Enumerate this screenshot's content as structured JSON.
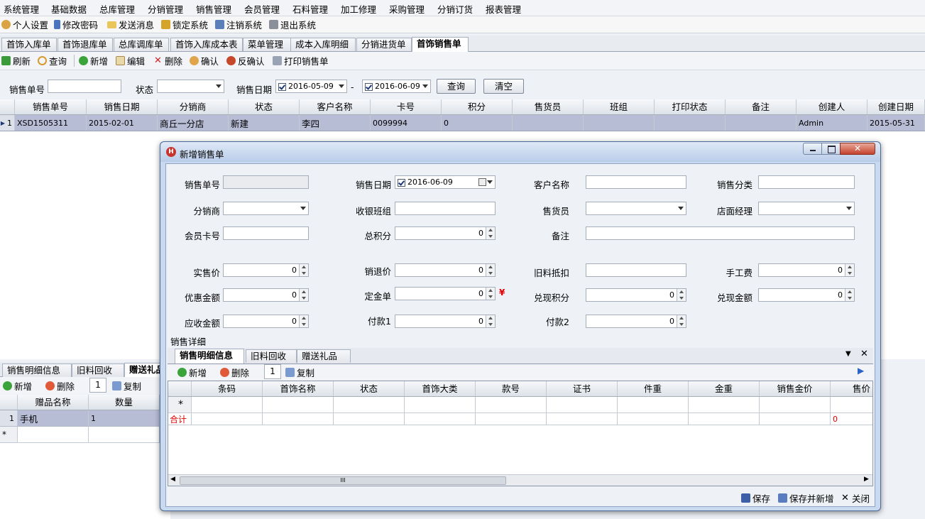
{
  "menu": [
    "系统管理",
    "基础数据",
    "总库管理",
    "分销管理",
    "销售管理",
    "会员管理",
    "石料管理",
    "加工修理",
    "采购管理",
    "分销订货",
    "报表管理"
  ],
  "quickbar": [
    {
      "label": "个人设置",
      "icon": "user-icon"
    },
    {
      "label": "修改密码",
      "icon": "key-icon"
    },
    {
      "label": "发送消息",
      "icon": "mail-icon"
    },
    {
      "label": "锁定系统",
      "icon": "lock-icon"
    },
    {
      "label": "注销系统",
      "icon": "logout-icon"
    },
    {
      "label": "退出系统",
      "icon": "home-icon"
    }
  ],
  "tabs": [
    "首饰入库单",
    "首饰退库单",
    "总库调库单",
    "首饰入库成本表",
    "菜单管理",
    "成本入库明细",
    "分销进货单",
    "首饰销售单"
  ],
  "active_tab": "首饰销售单",
  "toolbar": [
    {
      "label": "刷新",
      "icon": "refresh-icon"
    },
    {
      "label": "查询",
      "icon": "search-icon"
    },
    {
      "label": "新增",
      "icon": "add-icon"
    },
    {
      "label": "编辑",
      "icon": "edit-icon"
    },
    {
      "label": "删除",
      "icon": "delete-icon"
    },
    {
      "label": "确认",
      "icon": "confirm-icon"
    },
    {
      "label": "反确认",
      "icon": "unconfirm-icon"
    },
    {
      "label": "打印销售单",
      "icon": "print-icon"
    }
  ],
  "filter": {
    "sale_no_label": "销售单号",
    "status_label": "状态",
    "date_label": "销售日期",
    "date_from": "2016-05-09",
    "dash": "-",
    "date_to": "2016-06-09",
    "query_btn": "查询",
    "clear_btn": "清空"
  },
  "main_grid": {
    "columns": [
      "销售单号",
      "销售日期",
      "分销商",
      "状态",
      "客户名称",
      "卡号",
      "积分",
      "售货员",
      "班组",
      "打印状态",
      "备注",
      "创建人",
      "创建日期"
    ],
    "rows": [
      {
        "num": "1",
        "cells": [
          "XSD1505311",
          "2015-02-01",
          "商丘一分店",
          "新建",
          "李四",
          "0099994",
          "0",
          "",
          "",
          "",
          "",
          "Admin",
          "2015-05-31"
        ]
      }
    ]
  },
  "lower": {
    "tabs": [
      "销售明细信息",
      "旧料回收",
      "赠送礼品"
    ],
    "toolbar": {
      "add": "新增",
      "delete": "删除",
      "page": "1",
      "copy": "复制"
    },
    "columns": [
      "赠品名称",
      "数量"
    ],
    "rows": [
      {
        "num": "1",
        "cells": [
          "手机",
          "1"
        ]
      }
    ],
    "new_row_marker": "*"
  },
  "modal": {
    "title": "新增销售单",
    "fields": {
      "sale_no": "销售单号",
      "sale_date": "销售日期",
      "sale_date_value": "2016-06-09",
      "customer": "客户名称",
      "category": "销售分类",
      "distributor": "分销商",
      "cashier_group": "收银班组",
      "salesperson": "售货员",
      "store_manager": "店面经理",
      "member_card": "会员卡号",
      "total_points": "总积分",
      "total_points_value": "0",
      "remark": "备注",
      "actual_price": "实售价",
      "actual_price_value": "0",
      "return_price": "销退价",
      "return_price_value": "0",
      "old_deduct": "旧料抵扣",
      "labor_fee": "手工费",
      "labor_fee_value": "0",
      "discount": "优惠金额",
      "discount_value": "0",
      "deposit": "定金单",
      "deposit_value": "0",
      "currency": "¥",
      "redeem_points": "兑现积分",
      "redeem_points_value": "0",
      "redeem_amount": "兑现金额",
      "redeem_amount_value": "0",
      "receivable": "应收金额",
      "receivable_value": "0",
      "pay1": "付款1",
      "pay1_value": "0",
      "pay2": "付款2",
      "pay2_value": "0"
    },
    "detail_section": "销售详细",
    "detail_tabs": [
      "销售明细信息",
      "旧料回收",
      "赠送礼品"
    ],
    "detail_toolbar": {
      "add": "新增",
      "delete": "删除",
      "page": "1",
      "copy": "复制"
    },
    "detail_columns": [
      "条码",
      "首饰名称",
      "状态",
      "首饰大类",
      "款号",
      "证书",
      "件重",
      "金重",
      "销售金价",
      "售价"
    ],
    "new_row_marker": "*",
    "total_label": "合计",
    "total_value": "0",
    "scroll_grip": "III",
    "footer": {
      "save": "保存",
      "save_new": "保存并新增",
      "close": "关闭"
    }
  },
  "colors": {
    "accent": "#1d3a78",
    "selected_row": "#b8bdd6",
    "red": "#e00000"
  }
}
